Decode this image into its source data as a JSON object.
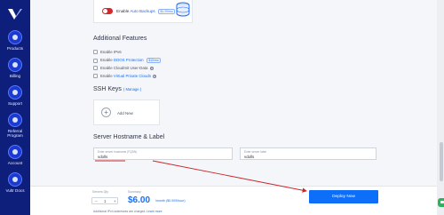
{
  "sidebar": {
    "items": [
      {
        "label": "Products",
        "icon": "products-icon"
      },
      {
        "label": "Billing",
        "icon": "billing-icon"
      },
      {
        "label": "Support",
        "icon": "support-icon"
      },
      {
        "label": "Referral Program",
        "icon": "referral-icon"
      },
      {
        "label": "Account",
        "icon": "account-icon"
      },
      {
        "label": "Vultr Docs",
        "icon": "docs-icon"
      }
    ]
  },
  "backup": {
    "prefix": "Enable ",
    "highlight": "Auto Backups",
    "badge": "$1.20/mo"
  },
  "additional_features": {
    "title": "Additional Features",
    "items": [
      {
        "prefix": "Enable IPv6",
        "highlight": "",
        "suffix": "",
        "badge": "",
        "help": false
      },
      {
        "prefix": "Enable ",
        "highlight": "DDOS Protection",
        "suffix": "",
        "badge": "$10/mo",
        "help": false
      },
      {
        "prefix": "Enable CloudInit User-Data",
        "highlight": "",
        "suffix": "",
        "badge": "",
        "help": true
      },
      {
        "prefix": "Enable ",
        "highlight": "Virtual Private Clouds",
        "suffix": "",
        "badge": "",
        "help": true
      }
    ]
  },
  "ssh_keys": {
    "title": "SSH Keys",
    "manage": "( Manage )",
    "add_label": "Add New",
    "plus_symbol": "+"
  },
  "hostname_section": {
    "title": "Server Hostname & Label",
    "hostname_label": "Enter server hostname (FQDN)",
    "hostname_value": "vdolls",
    "label_label": "Enter server label",
    "label_value": "vdolls"
  },
  "footer": {
    "qty_label": "Servers Qty",
    "qty_value": "1",
    "minus": "−",
    "plus": "+",
    "price_label": "Summary:",
    "price": "$6.00",
    "price_unit": "/month ($0.009/hour)",
    "ipv6_prefix": "Additional IPv4 addresses are charged. ",
    "ipv6_link": "Learn more",
    "deploy_label": "Deploy Now"
  },
  "colors": {
    "sidebar": "#0e1e7b",
    "accent": "#1a6ef5",
    "toggle_off": "#d9262b",
    "annotation": "#c9262c",
    "chat": "#2cb35d"
  }
}
